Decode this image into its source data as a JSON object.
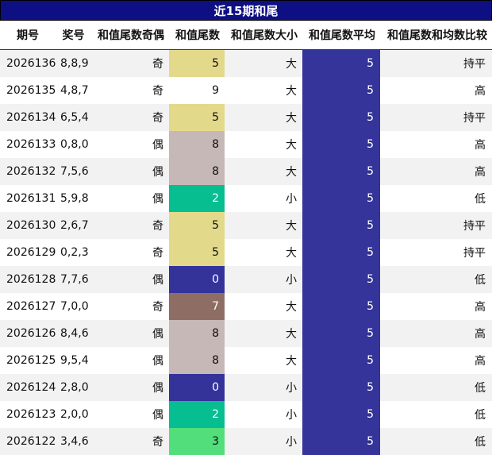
{
  "title": "近15期和尾",
  "headers": [
    "期号",
    "奖号",
    "和值尾数奇偶",
    "和值尾数",
    "和值尾数大小",
    "和值尾数平均",
    "和值尾数和均数比较"
  ],
  "tail_colors": {
    "0": "#33339a",
    "2": "#06be90",
    "3": "#52de7a",
    "5": "#e3d98b",
    "7": "#8e6e64",
    "8": "#c6b8b6",
    "9": "#ffffff"
  },
  "rows": [
    {
      "issue": "2026136",
      "nums": "8,8,9",
      "parity": "奇",
      "tail": "5",
      "size": "大",
      "avg": "5",
      "cmp": "持平"
    },
    {
      "issue": "2026135",
      "nums": "4,8,7",
      "parity": "奇",
      "tail": "9",
      "size": "大",
      "avg": "5",
      "cmp": "高"
    },
    {
      "issue": "2026134",
      "nums": "6,5,4",
      "parity": "奇",
      "tail": "5",
      "size": "大",
      "avg": "5",
      "cmp": "持平"
    },
    {
      "issue": "2026133",
      "nums": "0,8,0",
      "parity": "偶",
      "tail": "8",
      "size": "大",
      "avg": "5",
      "cmp": "高"
    },
    {
      "issue": "2026132",
      "nums": "7,5,6",
      "parity": "偶",
      "tail": "8",
      "size": "大",
      "avg": "5",
      "cmp": "高"
    },
    {
      "issue": "2026131",
      "nums": "5,9,8",
      "parity": "偶",
      "tail": "2",
      "size": "小",
      "avg": "5",
      "cmp": "低"
    },
    {
      "issue": "2026130",
      "nums": "2,6,7",
      "parity": "奇",
      "tail": "5",
      "size": "大",
      "avg": "5",
      "cmp": "持平"
    },
    {
      "issue": "2026129",
      "nums": "0,2,3",
      "parity": "奇",
      "tail": "5",
      "size": "大",
      "avg": "5",
      "cmp": "持平"
    },
    {
      "issue": "2026128",
      "nums": "7,7,6",
      "parity": "偶",
      "tail": "0",
      "size": "小",
      "avg": "5",
      "cmp": "低"
    },
    {
      "issue": "2026127",
      "nums": "7,0,0",
      "parity": "奇",
      "tail": "7",
      "size": "大",
      "avg": "5",
      "cmp": "高"
    },
    {
      "issue": "2026126",
      "nums": "8,4,6",
      "parity": "偶",
      "tail": "8",
      "size": "大",
      "avg": "5",
      "cmp": "高"
    },
    {
      "issue": "2026125",
      "nums": "9,5,4",
      "parity": "偶",
      "tail": "8",
      "size": "大",
      "avg": "5",
      "cmp": "高"
    },
    {
      "issue": "2026124",
      "nums": "2,8,0",
      "parity": "偶",
      "tail": "0",
      "size": "小",
      "avg": "5",
      "cmp": "低"
    },
    {
      "issue": "2026123",
      "nums": "2,0,0",
      "parity": "偶",
      "tail": "2",
      "size": "小",
      "avg": "5",
      "cmp": "低"
    },
    {
      "issue": "2026122",
      "nums": "3,4,6",
      "parity": "奇",
      "tail": "3",
      "size": "小",
      "avg": "5",
      "cmp": "低"
    }
  ]
}
